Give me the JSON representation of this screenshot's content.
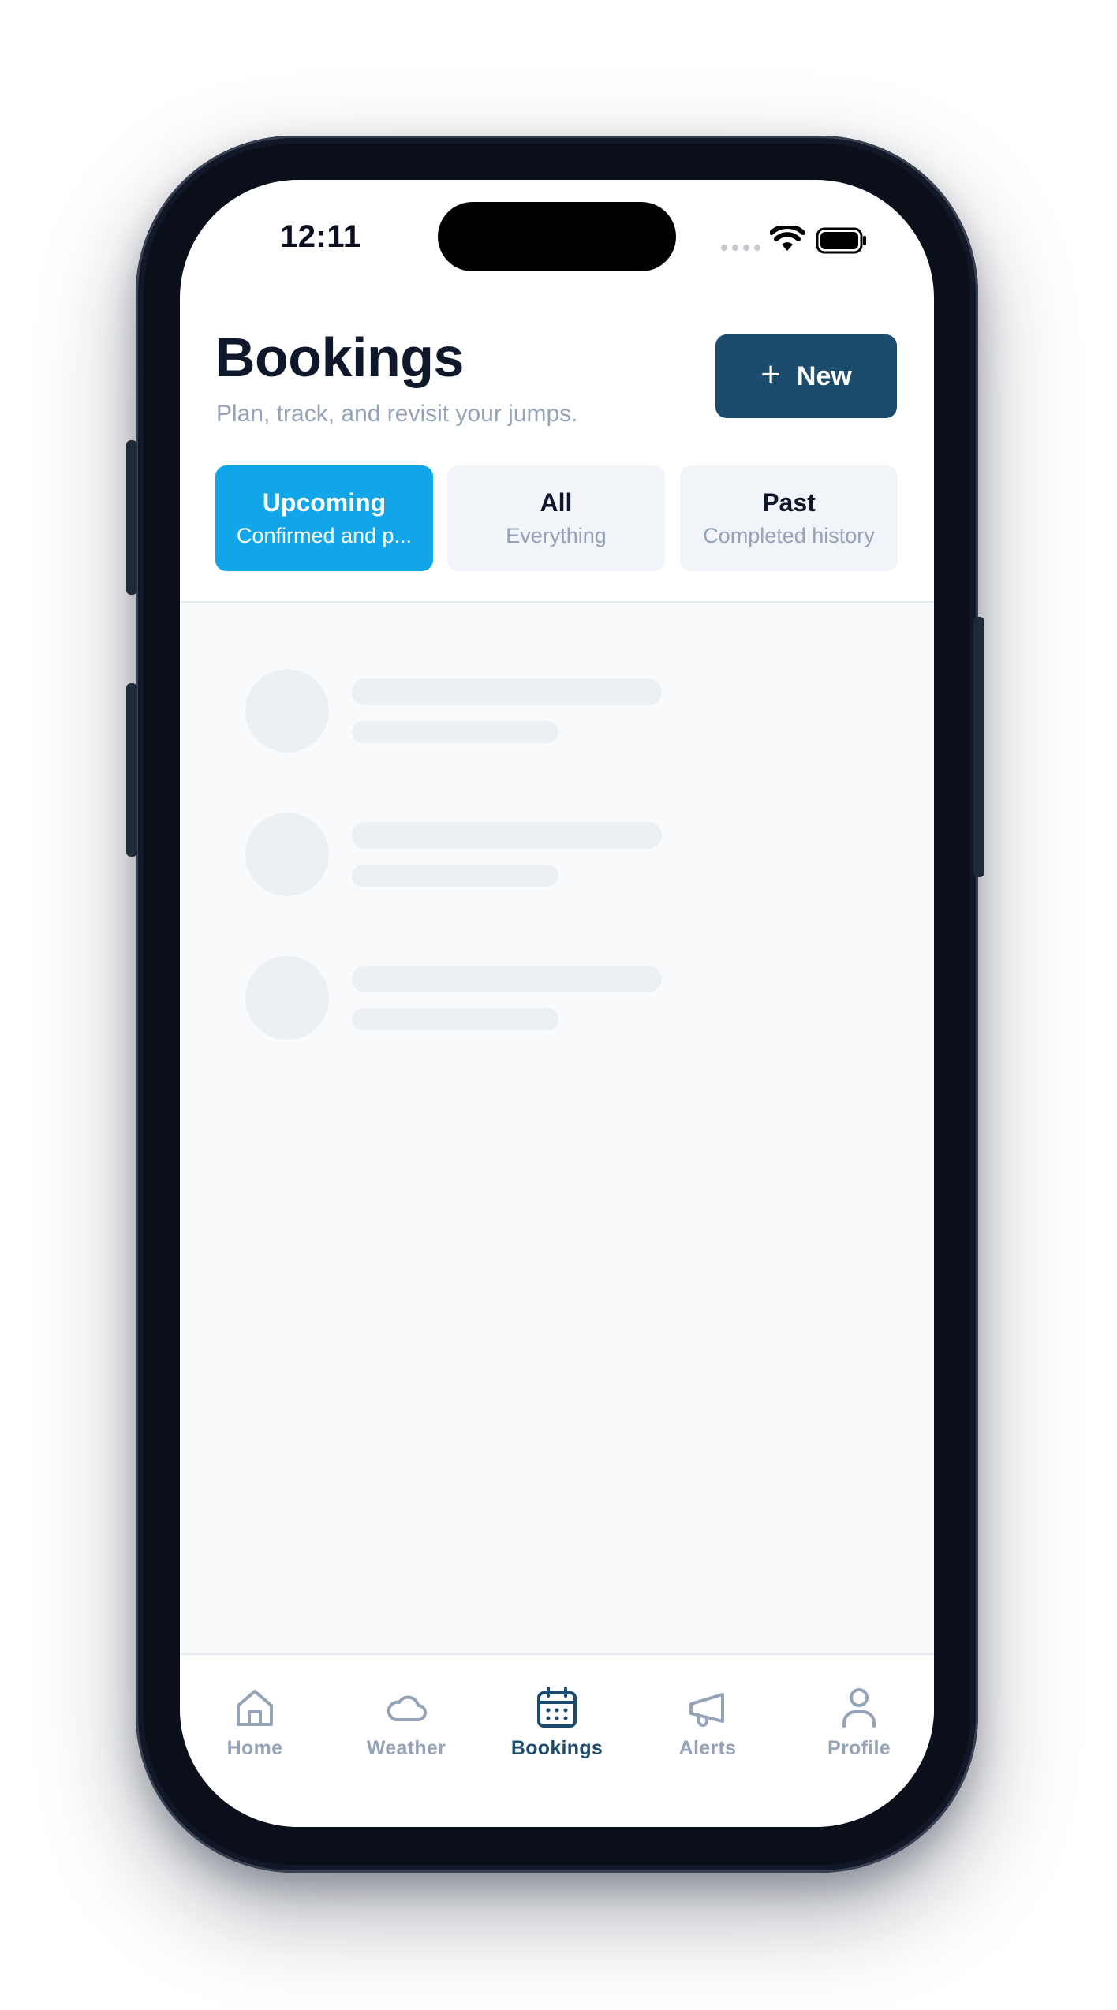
{
  "status_bar": {
    "time": "12:11"
  },
  "header": {
    "title": "Bookings",
    "subtitle": "Plan, track, and revisit your jumps.",
    "new_button": {
      "icon": "plus-icon",
      "label": "New"
    }
  },
  "filter_tabs": [
    {
      "label": "Upcoming",
      "sublabel": "Confirmed and p...",
      "selected": true
    },
    {
      "label": "All",
      "sublabel": "Everything",
      "selected": false
    },
    {
      "label": "Past",
      "sublabel": "Completed history",
      "selected": false
    }
  ],
  "content": {
    "state": "loading",
    "skeleton_rows": 3
  },
  "tab_bar": [
    {
      "label": "Home",
      "icon": "home-icon",
      "active": false
    },
    {
      "label": "Weather",
      "icon": "cloud-icon",
      "active": false
    },
    {
      "label": "Bookings",
      "icon": "calendar-icon",
      "active": true
    },
    {
      "label": "Alerts",
      "icon": "megaphone-icon",
      "active": false
    },
    {
      "label": "Profile",
      "icon": "user-icon",
      "active": false
    }
  ],
  "colors": {
    "primary": "#1b4c6e",
    "accent": "#12a6e8",
    "muted_text": "#94a3b8",
    "title_text": "#0f172a",
    "surface": "#f8fafc"
  }
}
